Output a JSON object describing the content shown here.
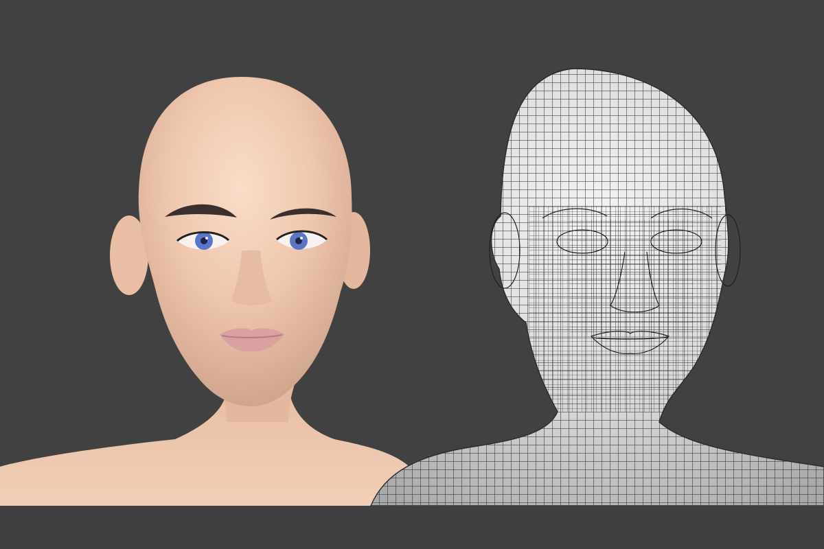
{
  "scene": {
    "background_color": "#414141",
    "left_model": {
      "label": "shaded-head-render",
      "skin_color": "#f2cdb4",
      "eye_color": "#5b75c9",
      "brow_color": "#3b302d",
      "lip_color": "#d9a1a0"
    },
    "right_model": {
      "label": "wireframe-head-render",
      "surface_color": "#dedede",
      "wire_color": "#1f1f1f"
    }
  }
}
